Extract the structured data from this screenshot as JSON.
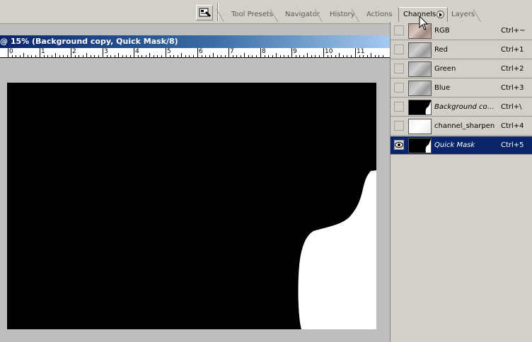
{
  "tabs": [
    {
      "label": "Tool Presets",
      "active": false
    },
    {
      "label": "Navigator",
      "active": false
    },
    {
      "label": "History",
      "active": false
    },
    {
      "label": "Actions",
      "active": false
    },
    {
      "label": "Channels",
      "active": true
    },
    {
      "label": "Layers",
      "active": false
    }
  ],
  "document": {
    "title": "@ 15% (Background copy, Quick Mask/8)"
  },
  "ruler": {
    "labels": [
      "0",
      "1",
      "2",
      "3",
      "4",
      "5",
      "6",
      "7",
      "8",
      "9",
      "10",
      "11"
    ]
  },
  "channels": [
    {
      "name": "RGB",
      "shortcut": "Ctrl+~",
      "thumb": "rgb",
      "visible": false,
      "selected": false,
      "italic": false
    },
    {
      "name": "Red",
      "shortcut": "Ctrl+1",
      "thumb": "gray",
      "visible": false,
      "selected": false,
      "italic": false
    },
    {
      "name": "Green",
      "shortcut": "Ctrl+2",
      "thumb": "gray",
      "visible": false,
      "selected": false,
      "italic": false
    },
    {
      "name": "Blue",
      "shortcut": "Ctrl+3",
      "thumb": "gray",
      "visible": false,
      "selected": false,
      "italic": false
    },
    {
      "name": "Background copy Mask",
      "shortcut": "Ctrl+\\",
      "thumb": "mask",
      "visible": false,
      "selected": false,
      "italic": true
    },
    {
      "name": "channel_sharpen",
      "shortcut": "Ctrl+4",
      "thumb": "light",
      "visible": false,
      "selected": false,
      "italic": false
    },
    {
      "name": "Quick Mask",
      "shortcut": "Ctrl+5",
      "thumb": "mask",
      "visible": true,
      "selected": true,
      "italic": true
    }
  ],
  "colors": {
    "selection": "#0a246a",
    "panel": "#d4d0c8",
    "workspace": "#bebebe"
  }
}
